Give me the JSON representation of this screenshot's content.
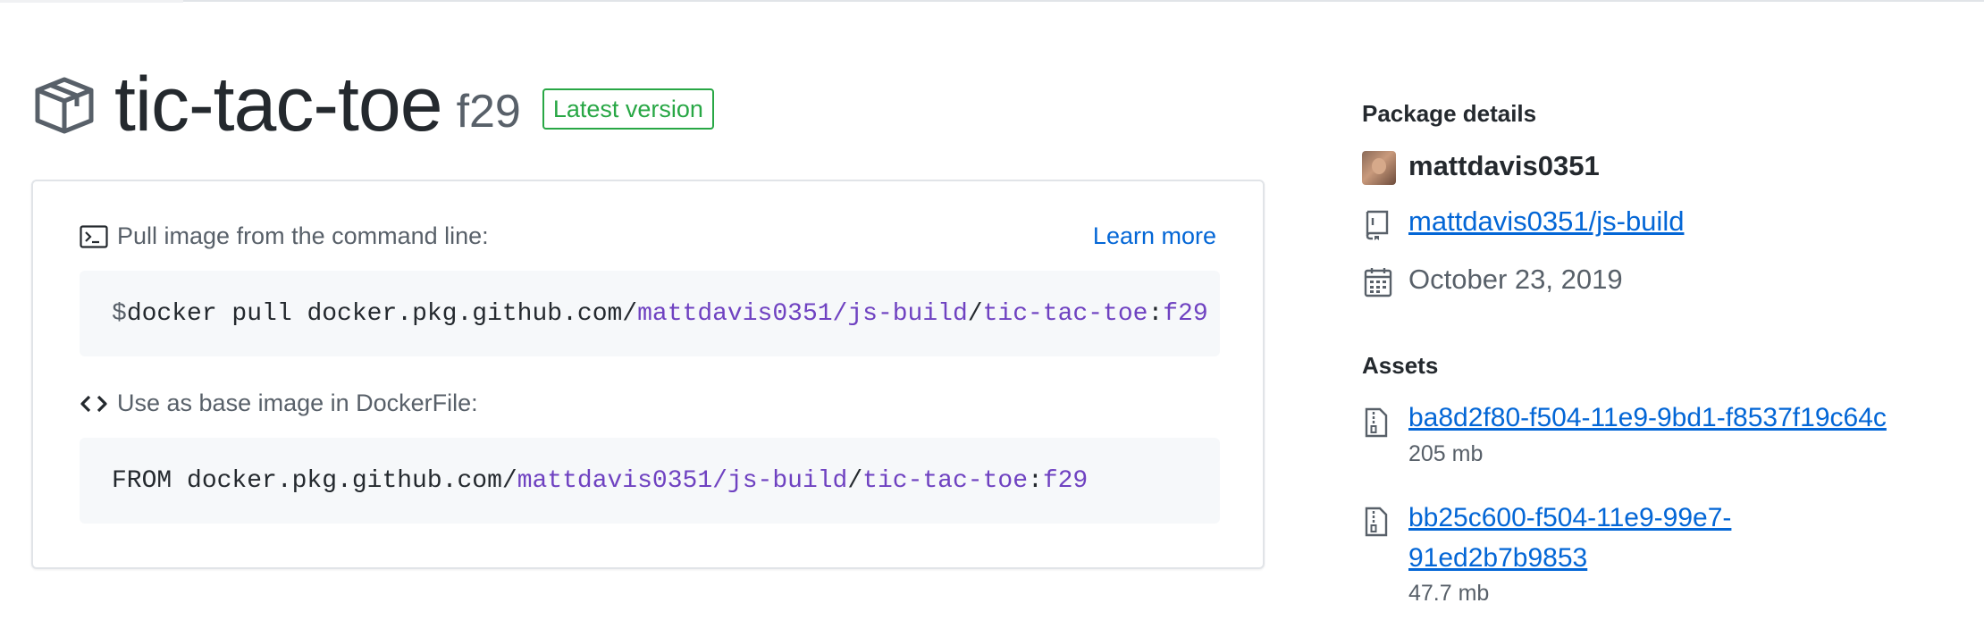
{
  "package": {
    "name": "tic-tac-toe",
    "version": "f29",
    "badge": "Latest version"
  },
  "pull": {
    "label": "Pull image from the command line:",
    "learn_more": "Learn more",
    "prompt": "$",
    "cmd_prefix": "docker pull docker.pkg.github.com/",
    "repo_path": "mattdavis0351/js-build",
    "slash": "/",
    "image": "tic-tac-toe",
    "colon": ":",
    "tag": "f29"
  },
  "base": {
    "label": "Use as base image in DockerFile:",
    "cmd_prefix": "FROM docker.pkg.github.com/",
    "repo_path": "mattdavis0351/js-build",
    "slash": "/",
    "image": "tic-tac-toe",
    "colon": ":",
    "tag": "f29"
  },
  "details": {
    "heading": "Package details",
    "owner": "mattdavis0351",
    "repo": "mattdavis0351/js-build",
    "date": "October 23, 2019"
  },
  "assets": {
    "heading": "Assets",
    "items": [
      {
        "name": "ba8d2f80-f504-11e9-9bd1-f8537f19c64c",
        "size": "205 mb"
      },
      {
        "name_line1": "bb25c600-f504-11e9-99e7-",
        "name_line2": "91ed2b7b9853",
        "size": "47.7 mb"
      }
    ]
  }
}
